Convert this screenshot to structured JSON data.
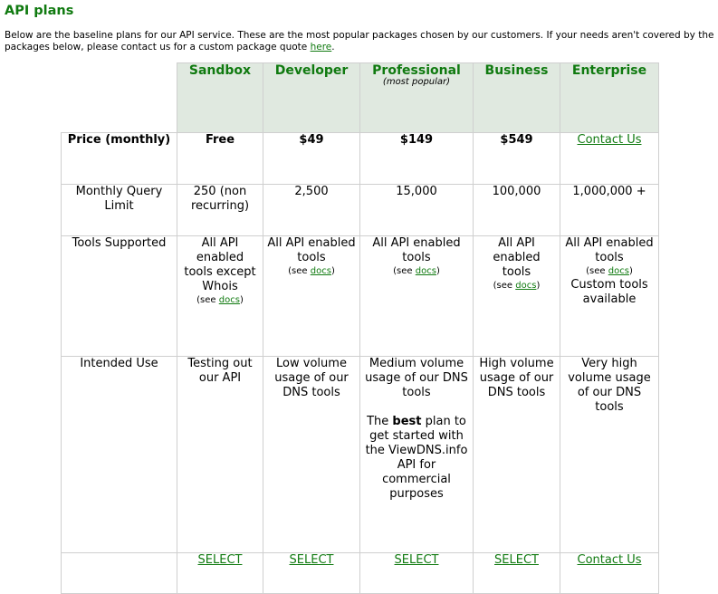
{
  "title": "API plans",
  "intro": {
    "text": "Below are the baseline plans for our API service. These are the most popular packages chosen by our customers. If your needs aren't covered by the packages below, please contact us for a custom package quote ",
    "link": "here",
    "after": "."
  },
  "plans": [
    {
      "name": "Sandbox"
    },
    {
      "name": "Developer"
    },
    {
      "name": "Professional",
      "note": "(most popular)"
    },
    {
      "name": "Business"
    },
    {
      "name": "Enterprise"
    }
  ],
  "rows": {
    "price": {
      "label": "Price (monthly)",
      "values": [
        "Free",
        "$49",
        "$149",
        "$549"
      ],
      "enterprise_link": "Contact Us"
    },
    "query": {
      "label": "Monthly Query Limit",
      "values": [
        "250 (non recurring)",
        "2,500",
        "15,000",
        "100,000",
        "1,000,000 +"
      ]
    },
    "tools": {
      "label": "Tools Supported",
      "values": [
        "All API enabled tools except Whois",
        "All API enabled tools",
        "All API enabled tools",
        "All API enabled tools",
        "All API enabled tools"
      ],
      "see_prefix": "(see ",
      "see_link": "docs",
      "see_suffix": ")",
      "enterprise_extra": "Custom tools available"
    },
    "use": {
      "label": "Intended Use",
      "values": [
        "Testing out our API",
        "Low volume usage of our DNS tools",
        "Medium volume usage of our DNS tools",
        "High volume usage of our DNS tools",
        "Very high volume usage of our DNS tools"
      ],
      "professional_extra": {
        "before": "The ",
        "bold": "best",
        "after": " plan to get started with the ViewDNS.info API for commercial purposes"
      }
    },
    "select": {
      "label": "SELECT",
      "enterprise_label": "Contact Us"
    }
  }
}
